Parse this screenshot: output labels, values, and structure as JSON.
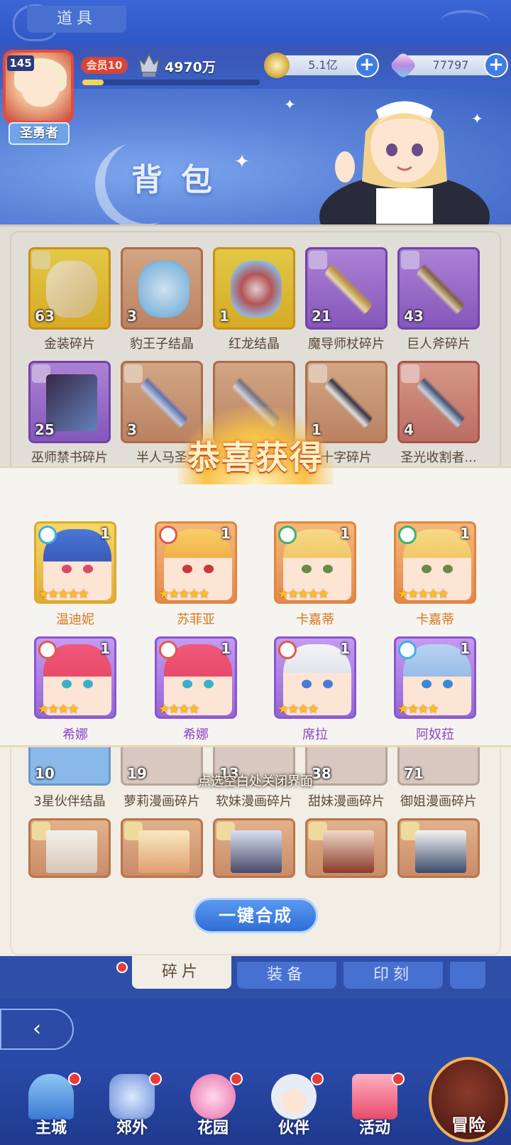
{
  "hud": {
    "player_level": "145",
    "player_title": "圣勇者",
    "vip": "会员10",
    "power": "4970万",
    "exp_progress": 0.12,
    "gold": "5.1亿",
    "diamonds": "77797"
  },
  "banner": {
    "title": "背包"
  },
  "inventory": {
    "row1": [
      {
        "name": "金装碎片",
        "count": "63",
        "rarity": "gold"
      },
      {
        "name": "豹王子结晶",
        "count": "3",
        "rarity": "orange"
      },
      {
        "name": "红龙结晶",
        "count": "1",
        "rarity": "gold"
      },
      {
        "name": "魔导师杖碎片",
        "count": "21",
        "rarity": "purple"
      },
      {
        "name": "巨人斧碎片",
        "count": "43",
        "rarity": "purple"
      }
    ],
    "row2": [
      {
        "name": "巫师禁书碎片",
        "count": "25",
        "rarity": "purple"
      },
      {
        "name": "半人马圣",
        "count": "3",
        "rarity": "orange"
      },
      {
        "name": "",
        "count": "",
        "rarity": "orange"
      },
      {
        "name": "十字碎片",
        "count": "1",
        "rarity": "orange"
      },
      {
        "name": "圣光收割者...",
        "count": "4",
        "rarity": "red"
      }
    ],
    "row5": [
      {
        "name": "3星伙伴结晶",
        "count": "10"
      },
      {
        "name": "萝莉漫画碎片",
        "count": "19"
      },
      {
        "name": "软妹漫画碎片",
        "count": "13"
      },
      {
        "name": "甜妹漫画碎片",
        "count": "38"
      },
      {
        "name": "御姐漫画碎片",
        "count": "71"
      }
    ]
  },
  "reward": {
    "title": "恭喜获得",
    "close_hint": "点选空白处关闭界面",
    "row1": [
      {
        "name": "温迪妮",
        "qty": "1",
        "stars": "★★★★★",
        "element": "water",
        "rarity": "gold"
      },
      {
        "name": "苏菲亚",
        "qty": "1",
        "stars": "★★★★★",
        "element": "fire",
        "rarity": "orange"
      },
      {
        "name": "卡嘉蒂",
        "qty": "1",
        "stars": "★★★★★",
        "element": "wind",
        "rarity": "orange"
      },
      {
        "name": "卡嘉蒂",
        "qty": "1",
        "stars": "★★★★★",
        "element": "wind",
        "rarity": "orange"
      }
    ],
    "row2": [
      {
        "name": "希娜",
        "qty": "1",
        "stars": "★★★★",
        "element": "fire",
        "rarity": "purple"
      },
      {
        "name": "希娜",
        "qty": "1",
        "stars": "★★★★",
        "element": "fire",
        "rarity": "purple"
      },
      {
        "name": "席拉",
        "qty": "1",
        "stars": "★★★★",
        "element": "fire",
        "rarity": "purple"
      },
      {
        "name": "阿奴菈",
        "qty": "1",
        "stars": "★★★★",
        "element": "water",
        "rarity": "purple"
      }
    ]
  },
  "merge_button": "一键合成",
  "tabs": [
    "道具",
    "碎片",
    "装备",
    "印刻"
  ],
  "bottom_nav": [
    "主城",
    "郊外",
    "花园",
    "伙伴",
    "活动",
    "冒险"
  ],
  "colors": {
    "accent": "#3f7de6",
    "reward_title": "#fff1c4",
    "badge": "#e93b3b"
  }
}
